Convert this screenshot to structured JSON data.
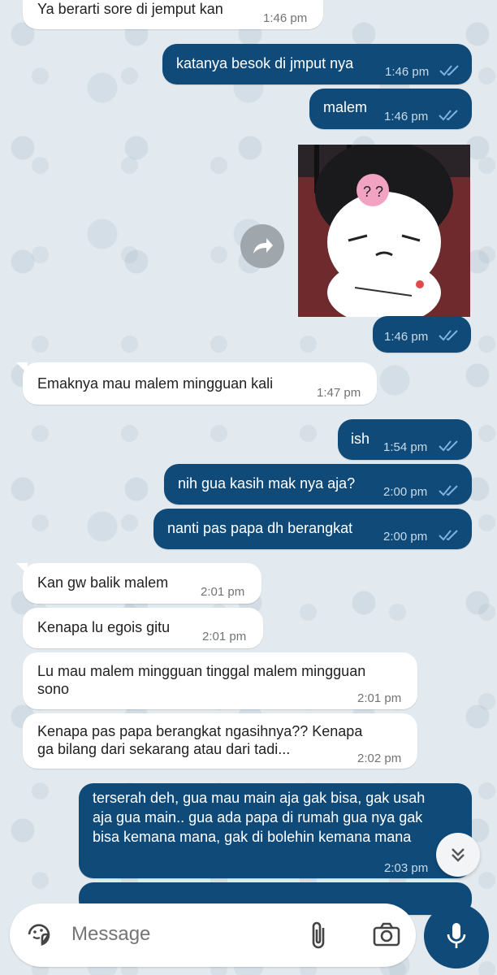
{
  "messages": [
    {
      "text": "Ya berarti sore di jemput kan",
      "time": "1:46 pm"
    },
    {
      "text": "katanya besok di jmput nya",
      "time": "1:46 pm"
    },
    {
      "text": "malem",
      "time": "1:46 pm"
    },
    {
      "text": "",
      "time": "1:46 pm"
    },
    {
      "text": "Emaknya mau malem mingguan kali",
      "time": "1:47 pm"
    },
    {
      "text": "ish",
      "time": "1:54 pm"
    },
    {
      "text": "nih gua kasih mak nya aja?",
      "time": "2:00 pm"
    },
    {
      "text": "nanti pas papa dh berangkat",
      "time": "2:00 pm"
    },
    {
      "text": "Kan gw balik malem",
      "time": "2:01 pm"
    },
    {
      "text": "Kenapa lu egois gitu",
      "time": "2:01 pm"
    },
    {
      "text": "Lu mau malem mingguan tinggal malem mingguan\nsono",
      "time": "2:01 pm"
    },
    {
      "text": "Kenapa pas papa berangkat ngasihnya?? Kenapa\nga bilang dari sekarang atau dari tadi...",
      "time": "2:02 pm"
    },
    {
      "text": "terserah deh, gua mau main aja gak bisa, gak usah\naja gua main.. gua ada papa di rumah gua nya gak\nbisa kemana mana, gak di bolehin kemana mana",
      "time": "2:03 pm"
    }
  ],
  "composer": {
    "placeholder": "Message"
  },
  "icons": {
    "sticker": "sticker-icon",
    "attach": "paperclip-icon",
    "camera": "camera-icon",
    "mic": "microphone-icon",
    "forward": "forward-icon",
    "scroll": "chevron-double-down-icon",
    "read": "double-check-icon"
  },
  "colors": {
    "outgoing": "#0f4a78",
    "incoming": "#ffffff",
    "ticks": "#7fb2e0"
  }
}
